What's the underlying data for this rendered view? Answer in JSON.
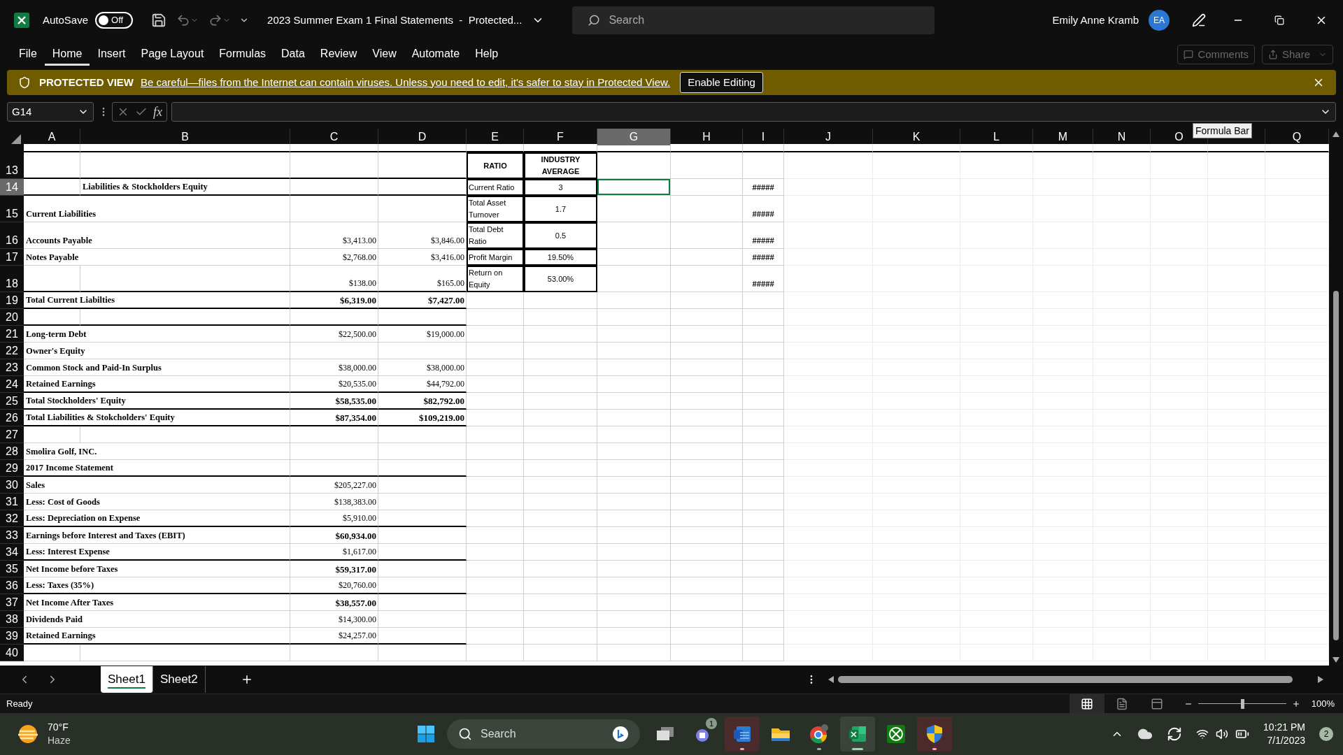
{
  "title_bar": {
    "autosave_label": "AutoSave",
    "autosave": {
      "on": false,
      "label": "Off"
    },
    "document_title": "2023 Summer Exam 1 Final Statements  -  Protected...",
    "search_placeholder": "Search",
    "user_name": "Emily Anne Kramb",
    "avatar_initials": "EA"
  },
  "ribbon_tabs": [
    {
      "label": "File",
      "selected": false
    },
    {
      "label": "Home",
      "selected": true
    },
    {
      "label": "Insert",
      "selected": false
    },
    {
      "label": "Page Layout",
      "selected": false
    },
    {
      "label": "Formulas",
      "selected": false
    },
    {
      "label": "Data",
      "selected": false
    },
    {
      "label": "Review",
      "selected": false
    },
    {
      "label": "View",
      "selected": false
    },
    {
      "label": "Automate",
      "selected": false
    },
    {
      "label": "Help",
      "selected": false
    }
  ],
  "ribbon_actions": [
    {
      "kind": "comments",
      "label": "Comments",
      "disabled": true
    },
    {
      "kind": "share",
      "label": "Share",
      "disabled": true
    }
  ],
  "protected_view": {
    "title": "PROTECTED VIEW",
    "message": "Be careful—files from the Internet can contain viruses. Unless you need to edit, it's safer to stay in Protected View.",
    "button": "Enable Editing"
  },
  "formula_bar": {
    "name_box": "G14",
    "function_label": "fx"
  },
  "columns": [
    {
      "label": "A",
      "selected": false
    },
    {
      "label": "B",
      "selected": false
    },
    {
      "label": "C",
      "selected": false
    },
    {
      "label": "D",
      "selected": false
    },
    {
      "label": "E",
      "selected": false
    },
    {
      "label": "F",
      "selected": false
    },
    {
      "label": "G",
      "selected": true
    },
    {
      "label": "H",
      "selected": false
    },
    {
      "label": "I",
      "selected": false
    },
    {
      "label": "J",
      "selected": false
    },
    {
      "label": "K",
      "selected": false
    },
    {
      "label": "L",
      "selected": false
    },
    {
      "label": "M",
      "selected": false
    },
    {
      "label": "N",
      "selected": false
    },
    {
      "label": "O",
      "selected": false
    },
    {
      "selected": false
    },
    {
      "label": "Q",
      "selected": false
    }
  ],
  "tooltip": "Formula Bar",
  "rows": [
    {
      "number": "13",
      "selected": false,
      "ruled": true,
      "cells": {
        "e": {
          "kind": "ratio_header",
          "text": "RATIO"
        },
        "f": {
          "kind": "ratio_header",
          "text": "INDUSTRY AVERAGE"
        }
      }
    },
    {
      "number": "14",
      "selected": true,
      "ruled": true,
      "cells": {
        "b": {
          "kind": "label",
          "text": "Liabilities & Stockholders Equity"
        },
        "e": {
          "kind": "ratio_name",
          "text": "Current Ratio"
        },
        "f": {
          "kind": "ratio_value",
          "text": "3"
        },
        "i": {
          "kind": "overflow",
          "text": "#####"
        }
      }
    },
    {
      "number": "15",
      "selected": false,
      "ruled": false,
      "cells": {
        "a": {
          "kind": "label",
          "text": "Current Liabilities"
        },
        "e": {
          "kind": "ratio_name",
          "text": "Total Asset Turnover"
        },
        "f": {
          "kind": "ratio_value",
          "text": "1.7"
        },
        "i": {
          "kind": "overflow",
          "text": "#####"
        }
      }
    },
    {
      "number": "16",
      "selected": false,
      "ruled": false,
      "cells": {
        "a": {
          "kind": "label",
          "text": "Accounts Payable"
        },
        "c": {
          "kind": "amount",
          "text": "$3,413.00",
          "bold": false
        },
        "d": {
          "kind": "amount",
          "text": "$3,846.00",
          "bold": false
        },
        "e": {
          "kind": "ratio_name",
          "text": "Total Debt Ratio"
        },
        "f": {
          "kind": "ratio_value",
          "text": "0.5"
        },
        "i": {
          "kind": "overflow",
          "text": "#####"
        }
      }
    },
    {
      "number": "17",
      "selected": false,
      "ruled": false,
      "cells": {
        "a": {
          "kind": "label",
          "text": "Notes Payable"
        },
        "c": {
          "kind": "amount",
          "text": "$2,768.00",
          "bold": false
        },
        "d": {
          "kind": "amount",
          "text": "$3,416.00",
          "bold": false
        },
        "e": {
          "kind": "ratio_name",
          "text": "Profit Margin"
        },
        "f": {
          "kind": "ratio_value",
          "text": "19.50%"
        },
        "i": {
          "kind": "overflow",
          "text": "#####"
        }
      }
    },
    {
      "number": "18",
      "selected": false,
      "ruled": true,
      "cells": {
        "c": {
          "kind": "amount",
          "text": "$138.00",
          "bold": false
        },
        "d": {
          "kind": "amount",
          "text": "$165.00",
          "bold": false
        },
        "e": {
          "kind": "ratio_name",
          "text": "Return on Equity"
        },
        "f": {
          "kind": "ratio_value",
          "text": "53.00%"
        },
        "i": {
          "kind": "overflow",
          "text": "#####"
        }
      }
    },
    {
      "number": "19",
      "selected": false,
      "ruled": true,
      "cells": {
        "a": {
          "kind": "label",
          "text": "Total Current Liabilties"
        },
        "c": {
          "kind": "amount",
          "text": "$6,319.00",
          "bold": true
        },
        "d": {
          "kind": "amount",
          "text": "$7,427.00",
          "bold": true
        }
      }
    },
    {
      "number": "20",
      "selected": false,
      "ruled": true,
      "cells": {}
    },
    {
      "number": "21",
      "selected": false,
      "ruled": false,
      "cells": {
        "a": {
          "kind": "label",
          "text": "Long-term Debt"
        },
        "c": {
          "kind": "amount",
          "text": "$22,500.00",
          "bold": false
        },
        "d": {
          "kind": "amount",
          "text": "$19,000.00",
          "bold": false
        }
      }
    },
    {
      "number": "22",
      "selected": false,
      "ruled": false,
      "cells": {
        "a": {
          "kind": "label",
          "text": "Owner's Equity"
        }
      }
    },
    {
      "number": "23",
      "selected": false,
      "ruled": false,
      "cells": {
        "a": {
          "kind": "label",
          "text": "Common Stock and Paid-In Surplus"
        },
        "c": {
          "kind": "amount",
          "text": "$38,000.00",
          "bold": false
        },
        "d": {
          "kind": "amount",
          "text": "$38,000.00",
          "bold": false
        }
      }
    },
    {
      "number": "24",
      "selected": false,
      "ruled": true,
      "cells": {
        "a": {
          "kind": "label",
          "text": "Retained Earnings"
        },
        "c": {
          "kind": "amount",
          "text": "$20,535.00",
          "bold": false
        },
        "d": {
          "kind": "amount",
          "text": "$44,792.00",
          "bold": false
        }
      }
    },
    {
      "number": "25",
      "selected": false,
      "ruled": true,
      "cells": {
        "a": {
          "kind": "label",
          "text": "Total Stockholders' Equity"
        },
        "c": {
          "kind": "amount",
          "text": "$58,535.00",
          "bold": true
        },
        "d": {
          "kind": "amount",
          "text": "$82,792.00",
          "bold": true
        }
      }
    },
    {
      "number": "26",
      "selected": false,
      "ruled": true,
      "cells": {
        "a": {
          "kind": "label",
          "text": "Total Liabilities & Stokcholders' Equity"
        },
        "c": {
          "kind": "amount",
          "text": "$87,354.00",
          "bold": true
        },
        "d": {
          "kind": "amount",
          "text": "$109,219.00",
          "bold": true
        }
      }
    },
    {
      "number": "27",
      "selected": false,
      "ruled": false,
      "cells": {}
    },
    {
      "number": "28",
      "selected": false,
      "ruled": false,
      "cells": {
        "a": {
          "kind": "label",
          "text": "Smolira Golf, INC."
        }
      }
    },
    {
      "number": "29",
      "selected": false,
      "ruled": true,
      "cells": {
        "a": {
          "kind": "label",
          "text": "2017 Income Statement"
        }
      }
    },
    {
      "number": "30",
      "selected": false,
      "ruled": false,
      "cells": {
        "a": {
          "kind": "label",
          "text": "Sales"
        },
        "c": {
          "kind": "amount",
          "text": "$205,227.00",
          "bold": false
        }
      }
    },
    {
      "number": "31",
      "selected": false,
      "ruled": false,
      "cells": {
        "a": {
          "kind": "label",
          "text": "Less: Cost of Goods"
        },
        "c": {
          "kind": "amount",
          "text": "$138,383.00",
          "bold": false
        }
      }
    },
    {
      "number": "32",
      "selected": false,
      "ruled": true,
      "cells": {
        "a": {
          "kind": "label",
          "text": "Less: Depreciation on Expense"
        },
        "c": {
          "kind": "amount",
          "text": "$5,910.00",
          "bold": false
        }
      }
    },
    {
      "number": "33",
      "selected": false,
      "ruled": false,
      "cells": {
        "a": {
          "kind": "label",
          "text": "Earnings before Interest and Taxes (EBIT)"
        },
        "c": {
          "kind": "amount",
          "text": "$60,934.00",
          "bold": true
        }
      }
    },
    {
      "number": "34",
      "selected": false,
      "ruled": true,
      "cells": {
        "a": {
          "kind": "label",
          "text": "Less: Interest Expense"
        },
        "c": {
          "kind": "amount",
          "text": "$1,617.00",
          "bold": false
        }
      }
    },
    {
      "number": "35",
      "selected": false,
      "ruled": false,
      "cells": {
        "a": {
          "kind": "label",
          "text": "Net Income before Taxes"
        },
        "c": {
          "kind": "amount",
          "text": "$59,317.00",
          "bold": true
        }
      }
    },
    {
      "number": "36",
      "selected": false,
      "ruled": true,
      "cells": {
        "a": {
          "kind": "label",
          "text": "Less: Taxes (35%)"
        },
        "c": {
          "kind": "amount",
          "text": "$20,760.00",
          "bold": false
        }
      }
    },
    {
      "number": "37",
      "selected": false,
      "ruled": false,
      "cells": {
        "a": {
          "kind": "label",
          "text": "Net Income After Taxes"
        },
        "c": {
          "kind": "amount",
          "text": "$38,557.00",
          "bold": true
        }
      }
    },
    {
      "number": "38",
      "selected": false,
      "ruled": false,
      "cells": {
        "a": {
          "kind": "label",
          "text": "Dividends Paid"
        },
        "c": {
          "kind": "amount",
          "text": "$14,300.00",
          "bold": false
        }
      }
    },
    {
      "number": "39",
      "selected": false,
      "ruled": true,
      "cells": {
        "a": {
          "kind": "label",
          "text": "Retained Earnings"
        },
        "c": {
          "kind": "amount",
          "text": "$24,257.00",
          "bold": false
        }
      }
    },
    {
      "number": "40",
      "selected": false,
      "ruled": false,
      "cells": {}
    }
  ],
  "sheet_tabs": [
    {
      "label": "Sheet1",
      "selected": true
    },
    {
      "label": "Sheet2",
      "selected": false
    }
  ],
  "status_bar": {
    "status": "Ready",
    "views": [
      {
        "kind": "normal",
        "selected": true
      },
      {
        "kind": "page_layout",
        "selected": false
      },
      {
        "kind": "page_break",
        "selected": false
      }
    ],
    "zoom": {
      "level": 0.5,
      "label": "100%"
    }
  },
  "taskbar": {
    "weather": {
      "temperature": "70°F",
      "condition": "Haze"
    },
    "search_label": "Search",
    "apps": [
      {
        "kind": "task_view",
        "open": false,
        "focused": false,
        "attention": false
      },
      {
        "kind": "chat",
        "open": false,
        "focused": false,
        "attention": false,
        "badge": "1"
      },
      {
        "kind": "word",
        "open": true,
        "focused": false,
        "attention": true
      },
      {
        "kind": "explorer",
        "open": false,
        "focused": false,
        "attention": false
      },
      {
        "kind": "chrome",
        "open": true,
        "focused": false,
        "attention": false
      },
      {
        "kind": "excel",
        "open": true,
        "focused": true,
        "attention": false
      },
      {
        "kind": "xbox",
        "open": false,
        "focused": false,
        "attention": false
      },
      {
        "kind": "security",
        "open": true,
        "focused": false,
        "attention": true
      }
    ],
    "clock": {
      "time": "10:21 PM",
      "date": "7/1/2023"
    },
    "notification_count": "2"
  }
}
